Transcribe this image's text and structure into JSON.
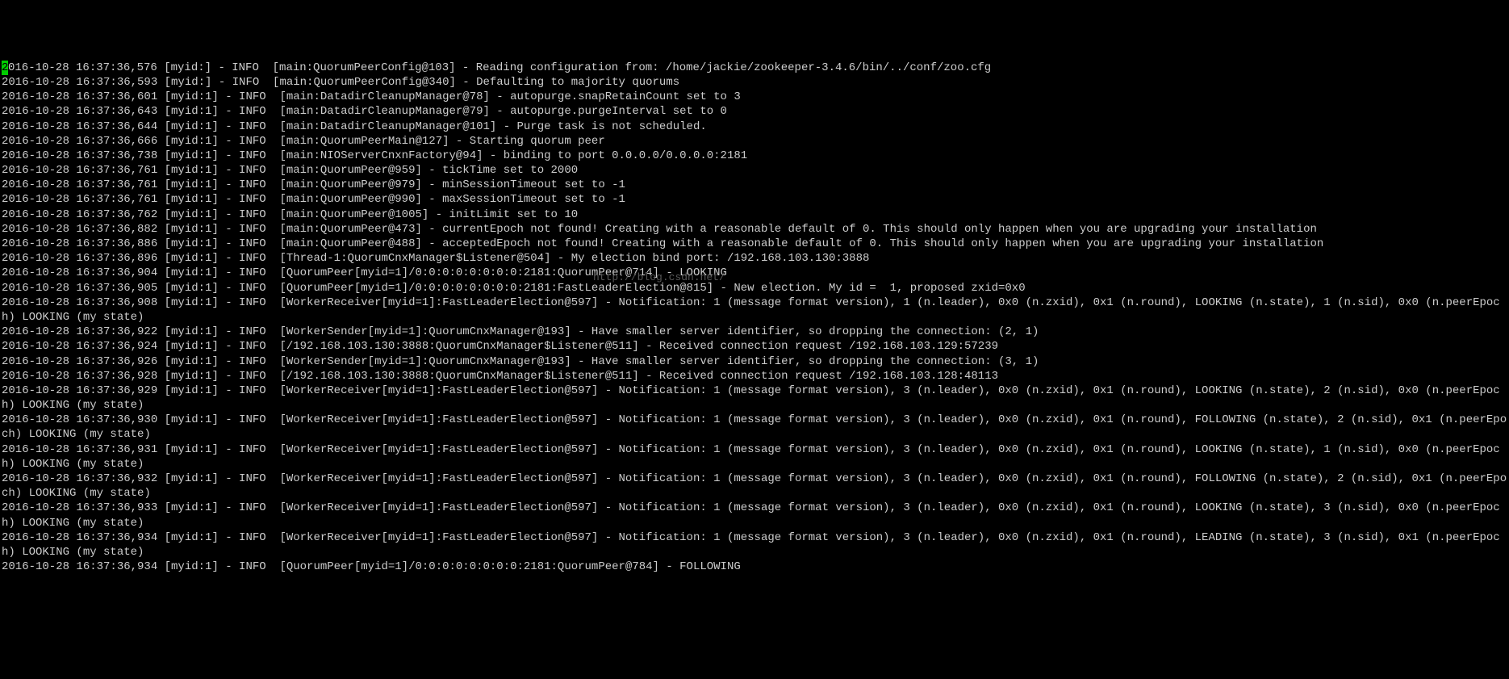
{
  "terminal": {
    "cursor_char": "2",
    "first_line_rest": "016-10-28 16:37:36,576 [myid:] - INFO  [main:QuorumPeerConfig@103] - Reading configuration from: /home/jackie/zookeeper-3.4.6/bin/../conf/zoo.cfg",
    "lines": [
      "2016-10-28 16:37:36,593 [myid:] - INFO  [main:QuorumPeerConfig@340] - Defaulting to majority quorums",
      "2016-10-28 16:37:36,601 [myid:1] - INFO  [main:DatadirCleanupManager@78] - autopurge.snapRetainCount set to 3",
      "2016-10-28 16:37:36,643 [myid:1] - INFO  [main:DatadirCleanupManager@79] - autopurge.purgeInterval set to 0",
      "2016-10-28 16:37:36,644 [myid:1] - INFO  [main:DatadirCleanupManager@101] - Purge task is not scheduled.",
      "2016-10-28 16:37:36,666 [myid:1] - INFO  [main:QuorumPeerMain@127] - Starting quorum peer",
      "2016-10-28 16:37:36,738 [myid:1] - INFO  [main:NIOServerCnxnFactory@94] - binding to port 0.0.0.0/0.0.0.0:2181",
      "2016-10-28 16:37:36,761 [myid:1] - INFO  [main:QuorumPeer@959] - tickTime set to 2000",
      "2016-10-28 16:37:36,761 [myid:1] - INFO  [main:QuorumPeer@979] - minSessionTimeout set to -1",
      "2016-10-28 16:37:36,761 [myid:1] - INFO  [main:QuorumPeer@990] - maxSessionTimeout set to -1",
      "2016-10-28 16:37:36,762 [myid:1] - INFO  [main:QuorumPeer@1005] - initLimit set to 10",
      "2016-10-28 16:37:36,882 [myid:1] - INFO  [main:QuorumPeer@473] - currentEpoch not found! Creating with a reasonable default of 0. This should only happen when you are upgrading your installation",
      "2016-10-28 16:37:36,886 [myid:1] - INFO  [main:QuorumPeer@488] - acceptedEpoch not found! Creating with a reasonable default of 0. This should only happen when you are upgrading your installation",
      "2016-10-28 16:37:36,896 [myid:1] - INFO  [Thread-1:QuorumCnxManager$Listener@504] - My election bind port: /192.168.103.130:3888",
      "2016-10-28 16:37:36,904 [myid:1] - INFO  [QuorumPeer[myid=1]/0:0:0:0:0:0:0:0:2181:QuorumPeer@714] - LOOKING",
      "2016-10-28 16:37:36,905 [myid:1] - INFO  [QuorumPeer[myid=1]/0:0:0:0:0:0:0:0:2181:FastLeaderElection@815] - New election. My id =  1, proposed zxid=0x0",
      "2016-10-28 16:37:36,908 [myid:1] - INFO  [WorkerReceiver[myid=1]:FastLeaderElection@597] - Notification: 1 (message format version), 1 (n.leader), 0x0 (n.zxid), 0x1 (n.round), LOOKING (n.state), 1 (n.sid), 0x0 (n.peerEpoch) LOOKING (my state)",
      "2016-10-28 16:37:36,922 [myid:1] - INFO  [WorkerSender[myid=1]:QuorumCnxManager@193] - Have smaller server identifier, so dropping the connection: (2, 1)",
      "2016-10-28 16:37:36,924 [myid:1] - INFO  [/192.168.103.130:3888:QuorumCnxManager$Listener@511] - Received connection request /192.168.103.129:57239",
      "2016-10-28 16:37:36,926 [myid:1] - INFO  [WorkerSender[myid=1]:QuorumCnxManager@193] - Have smaller server identifier, so dropping the connection: (3, 1)",
      "2016-10-28 16:37:36,928 [myid:1] - INFO  [/192.168.103.130:3888:QuorumCnxManager$Listener@511] - Received connection request /192.168.103.128:48113",
      "2016-10-28 16:37:36,929 [myid:1] - INFO  [WorkerReceiver[myid=1]:FastLeaderElection@597] - Notification: 1 (message format version), 3 (n.leader), 0x0 (n.zxid), 0x1 (n.round), LOOKING (n.state), 2 (n.sid), 0x0 (n.peerEpoch) LOOKING (my state)",
      "2016-10-28 16:37:36,930 [myid:1] - INFO  [WorkerReceiver[myid=1]:FastLeaderElection@597] - Notification: 1 (message format version), 3 (n.leader), 0x0 (n.zxid), 0x1 (n.round), FOLLOWING (n.state), 2 (n.sid), 0x1 (n.peerEpoch) LOOKING (my state)",
      "2016-10-28 16:37:36,931 [myid:1] - INFO  [WorkerReceiver[myid=1]:FastLeaderElection@597] - Notification: 1 (message format version), 3 (n.leader), 0x0 (n.zxid), 0x1 (n.round), LOOKING (n.state), 1 (n.sid), 0x0 (n.peerEpoch) LOOKING (my state)",
      "2016-10-28 16:37:36,932 [myid:1] - INFO  [WorkerReceiver[myid=1]:FastLeaderElection@597] - Notification: 1 (message format version), 3 (n.leader), 0x0 (n.zxid), 0x1 (n.round), FOLLOWING (n.state), 2 (n.sid), 0x1 (n.peerEpoch) LOOKING (my state)",
      "2016-10-28 16:37:36,933 [myid:1] - INFO  [WorkerReceiver[myid=1]:FastLeaderElection@597] - Notification: 1 (message format version), 3 (n.leader), 0x0 (n.zxid), 0x1 (n.round), LOOKING (n.state), 3 (n.sid), 0x0 (n.peerEpoch) LOOKING (my state)",
      "2016-10-28 16:37:36,934 [myid:1] - INFO  [WorkerReceiver[myid=1]:FastLeaderElection@597] - Notification: 1 (message format version), 3 (n.leader), 0x0 (n.zxid), 0x1 (n.round), LEADING (n.state), 3 (n.sid), 0x1 (n.peerEpoch) LOOKING (my state)",
      "2016-10-28 16:37:36,934 [myid:1] - INFO  [QuorumPeer[myid=1]/0:0:0:0:0:0:0:0:2181:QuorumPeer@784] - FOLLOWING"
    ]
  },
  "watermark": {
    "text": "http://blog.csdn.net/"
  }
}
